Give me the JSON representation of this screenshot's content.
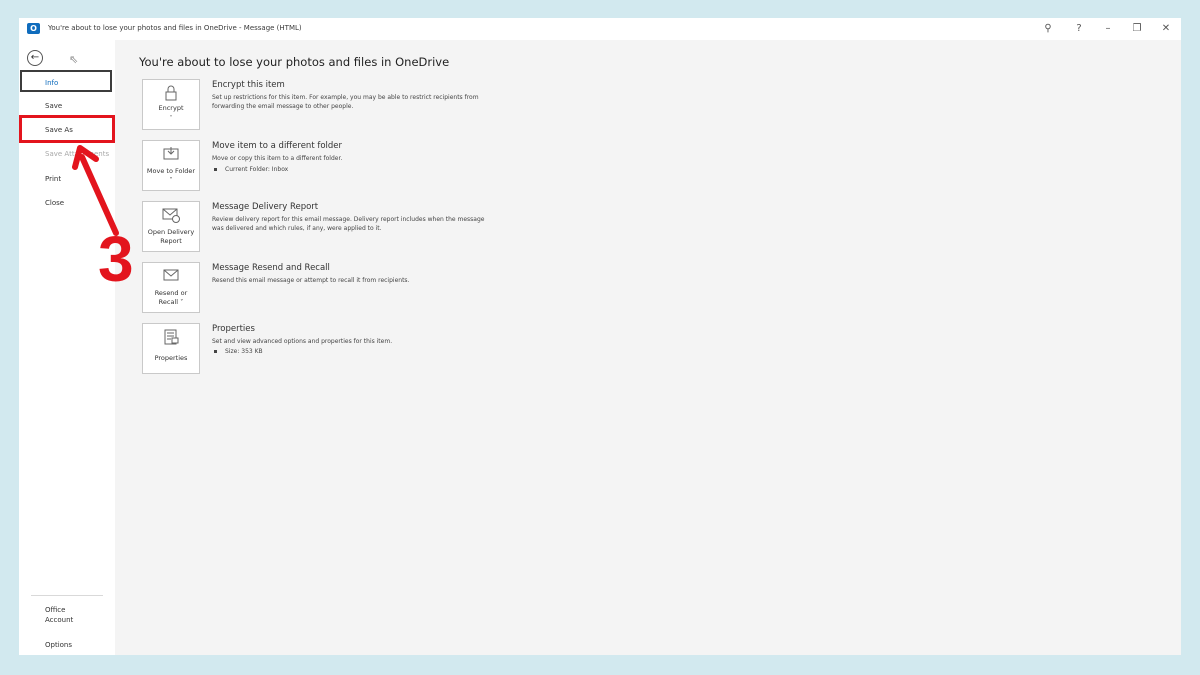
{
  "window": {
    "title": "You're about to lose your photos and files in OneDrive  -  Message (HTML)",
    "app_icon": "O",
    "controls": [
      "coauthor-icon",
      "help-icon",
      "minimize-icon",
      "restore-icon",
      "close-icon"
    ],
    "help_glyph": "?",
    "minimize_glyph": "–",
    "close_glyph": "✕",
    "restore_glyph": "❐",
    "coauthor_glyph": "⚲"
  },
  "nav": {
    "back_glyph": "←",
    "items": [
      {
        "label": "Info",
        "state": "active"
      },
      {
        "label": "Save",
        "state": "normal"
      },
      {
        "label": "Save As",
        "state": "normal"
      },
      {
        "label": "Save Attachments",
        "state": "disabled"
      },
      {
        "label": "Print",
        "state": "normal"
      },
      {
        "label": "Close",
        "state": "normal"
      }
    ],
    "bottom_items": [
      {
        "label": "Office Account"
      },
      {
        "label": "Options"
      }
    ]
  },
  "page": {
    "title": "You're about to lose your photos and files in OneDrive",
    "sections": [
      {
        "button_label": "Encrypt",
        "button_icon": "lock-icon",
        "title": "Encrypt this item",
        "description": "Set up restrictions for this item. For example, you may be able to restrict recipients from forwarding the email message to other people."
      },
      {
        "button_label": "Move to Folder ˅",
        "button_icon": "move-folder-icon",
        "title": "Move item to a different folder",
        "description": "Move or copy this item to a different folder.",
        "bullet": "Current Folder:   Inbox"
      },
      {
        "button_label": "Open Delivery Report",
        "button_icon": "delivery-report-icon",
        "title": "Message Delivery Report",
        "description": "Review delivery report for this email message. Delivery report includes when the message was delivered and which rules, if any, were applied to it."
      },
      {
        "button_label": "Resend or Recall ˅",
        "button_icon": "resend-recall-icon",
        "title": "Message Resend and Recall",
        "description": "Resend this email message or attempt to recall it from recipients."
      },
      {
        "button_label": "Properties",
        "button_icon": "properties-icon",
        "title": "Properties",
        "description": "Set and view advanced options and properties for this item.",
        "bullet": "Size:   353 KB"
      }
    ]
  },
  "annotation": {
    "step_number": "3",
    "color": "#e3141d"
  },
  "colors": {
    "background": "#d2e9ef",
    "accent": "#0f6cbd"
  }
}
